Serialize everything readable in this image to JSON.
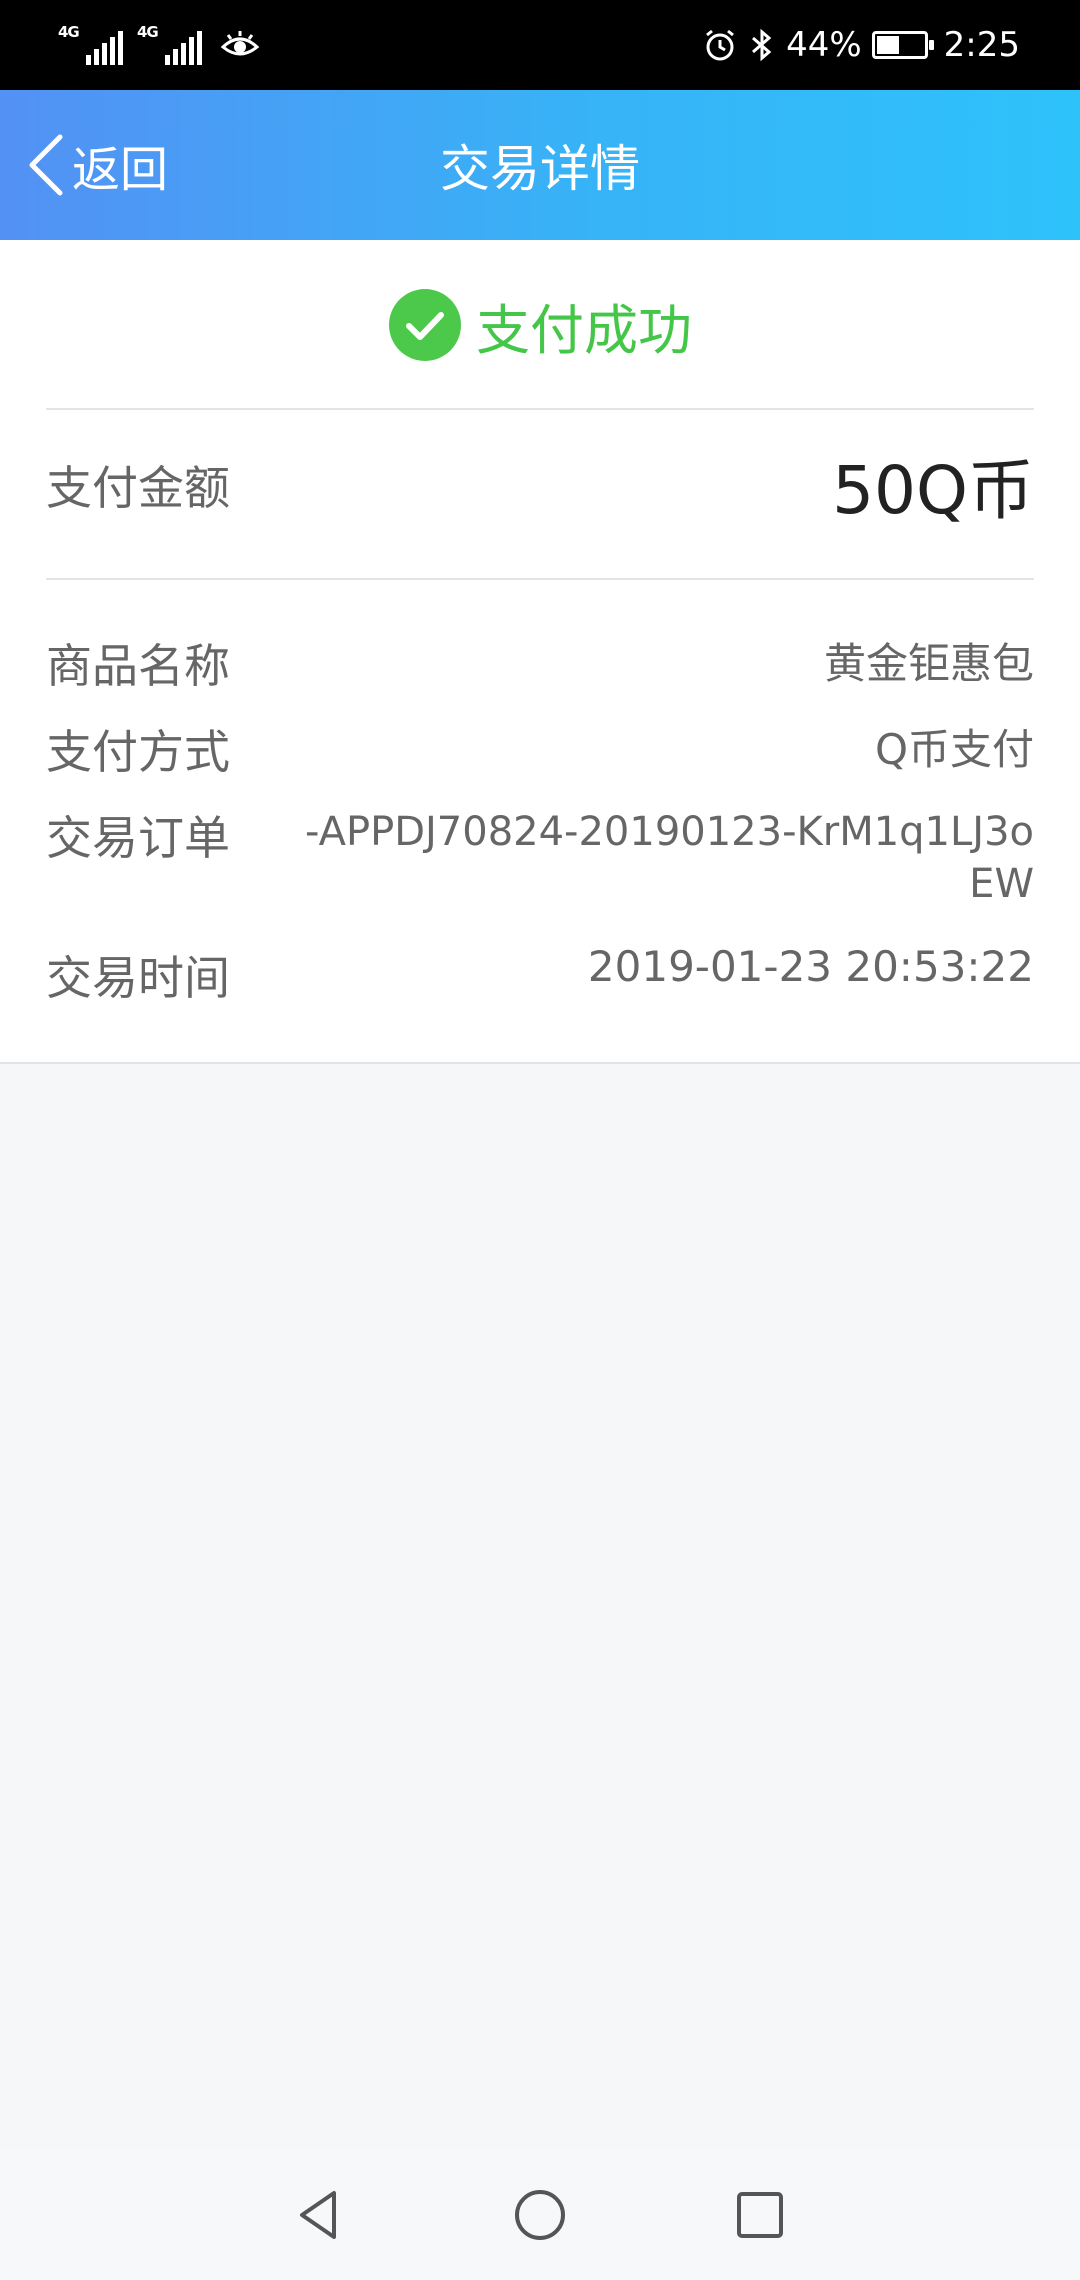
{
  "status_bar": {
    "net1": "4G",
    "net2": "4G",
    "battery_percent": "44%",
    "time": "2:25"
  },
  "header": {
    "back_label": "返回",
    "title": "交易详情"
  },
  "status": {
    "text": "支付成功",
    "color": "#44c649"
  },
  "amount": {
    "label": "支付金额",
    "value": "50Q币"
  },
  "details": {
    "product": {
      "label": "商品名称",
      "value": "黄金钜惠包"
    },
    "method": {
      "label": "支付方式",
      "value": "Q币支付"
    },
    "order": {
      "label": "交易订单",
      "value": "-APPDJ70824-20190123-KrM1q1LJ3oEW"
    },
    "time": {
      "label": "交易时间",
      "value": "2019-01-23 20:53:22"
    }
  },
  "colors": {
    "header_gradient_start": "#5391f4",
    "header_gradient_end": "#2ec2fb",
    "success": "#44c649"
  }
}
